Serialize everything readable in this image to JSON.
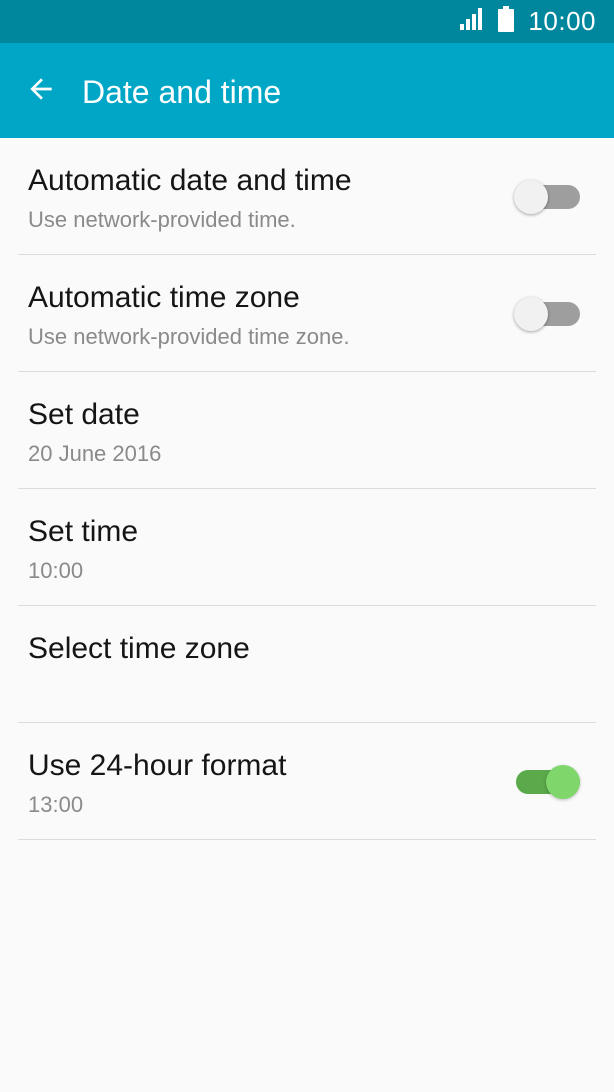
{
  "status_bar": {
    "time": "10:00",
    "signal_icon": "signal-icon",
    "battery_icon": "battery-icon"
  },
  "app_bar": {
    "back_icon": "arrow-left-icon",
    "title": "Date and time",
    "background_color": "#00a6c6"
  },
  "settings": [
    {
      "title": "Automatic date and time",
      "subtitle": "Use network-provided time.",
      "toggle": false
    },
    {
      "title": "Automatic time zone",
      "subtitle": "Use network-provided time zone.",
      "toggle": false
    },
    {
      "title": "Set date",
      "subtitle": "20 June 2016"
    },
    {
      "title": "Set time",
      "subtitle": "10:00"
    },
    {
      "title": "Select time zone",
      "subtitle": ""
    },
    {
      "title": "Use 24-hour format",
      "subtitle": "13:00",
      "toggle": true
    }
  ],
  "colors": {
    "status_bar": "#00879e",
    "toggle_on": "#7fd66b",
    "toggle_off": "#9e9e9e"
  }
}
